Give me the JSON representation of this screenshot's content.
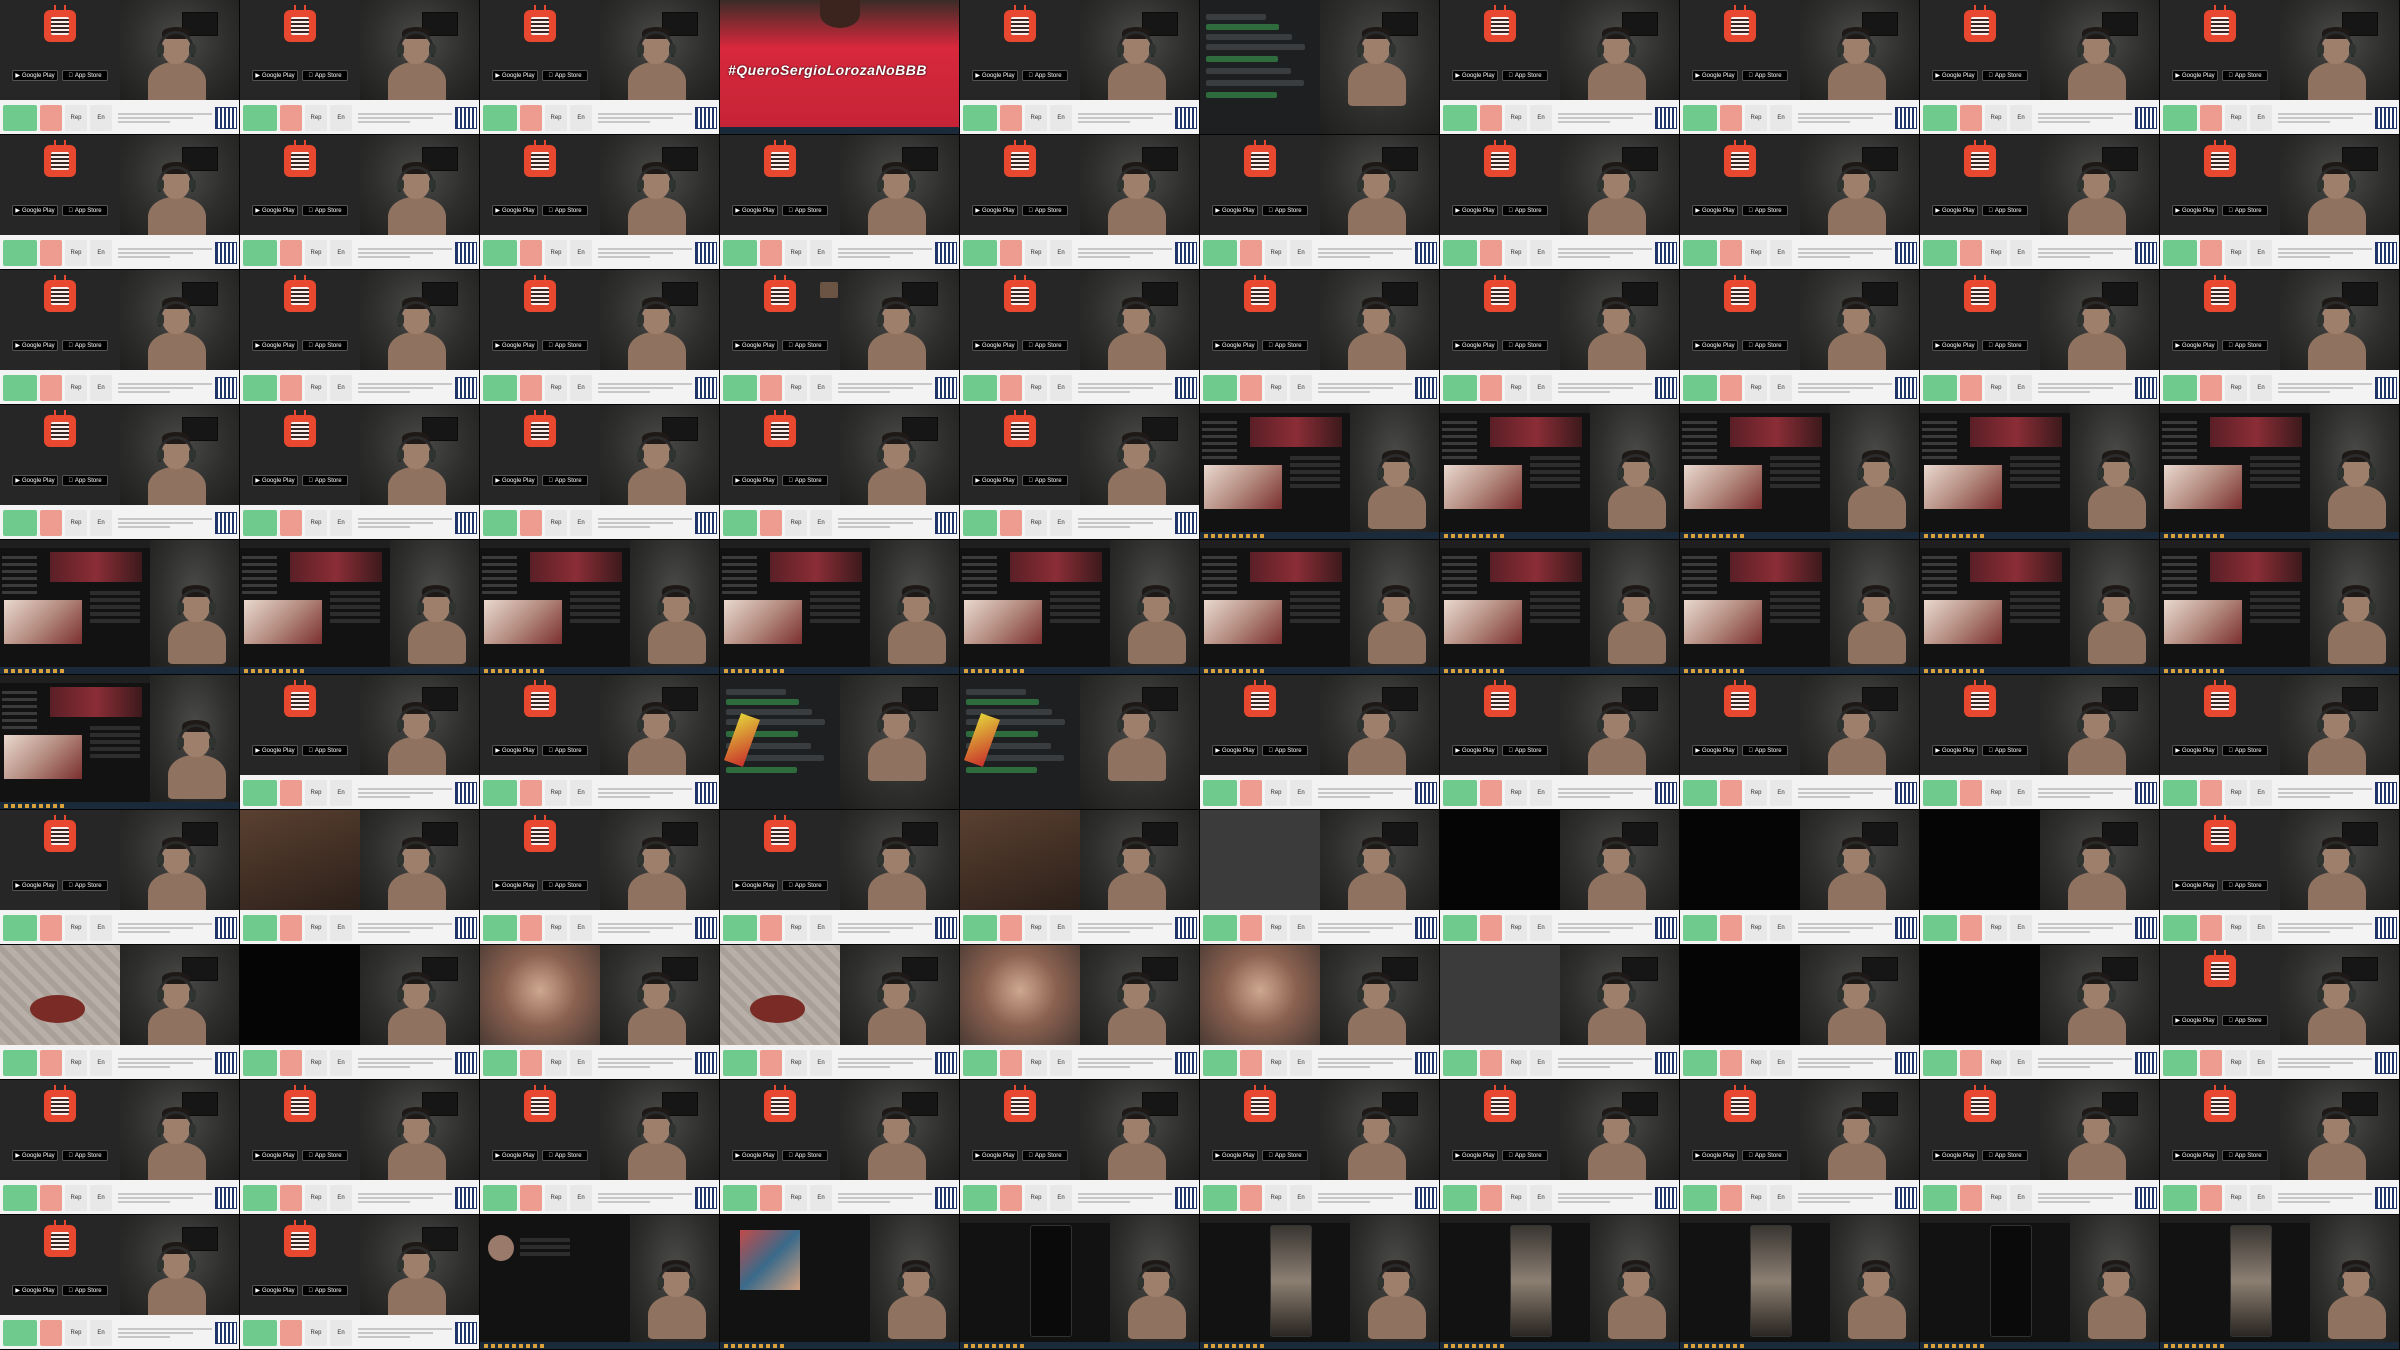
{
  "sheet": {
    "rows": 10,
    "cols": 10
  },
  "omegle": {
    "start_label": "",
    "stop_label": "",
    "report_label": "Rep",
    "lang_label": "En",
    "caption": "",
    "google_play": "Google Play",
    "app_store": "App Store",
    "ome_logo": "Ome TV"
  },
  "banner": {
    "hashtag": "#QueroSergioLorozaNoBBB"
  },
  "tiles": [
    "omegle",
    "omegle",
    "omegle",
    "redshirt",
    "omegle",
    "chatdark",
    "omegle-badge",
    "omegle-badge",
    "omegle-badge",
    "omegle-badge",
    "omegle-badge",
    "omegle-badge",
    "omegle-badge",
    "omegle-badge",
    "omegle",
    "omegle",
    "omegle",
    "omegle",
    "omegle",
    "omegle",
    "omegle",
    "omegle",
    "omegle",
    "omegle-avatar",
    "omegle",
    "omegle",
    "omegle",
    "omegle",
    "omegle",
    "omegle",
    "omegle",
    "omegle",
    "omegle",
    "omegle",
    "omegle",
    "app",
    "app",
    "app",
    "app",
    "app",
    "app",
    "app",
    "app",
    "app",
    "app",
    "app",
    "app",
    "app",
    "app",
    "app",
    "app",
    "omegle",
    "omegle",
    "chatdark2",
    "chatdark2",
    "omegle",
    "omegle",
    "omegle",
    "omegle",
    "omegle",
    "omegle",
    "omegle-photo",
    "ome",
    "ome",
    "photo2",
    "grey",
    "black",
    "black",
    "black",
    "omegle",
    "floor",
    "black",
    "face",
    "floor2",
    "face2",
    "face3",
    "grey",
    "black",
    "black",
    "omegle",
    "omegle",
    "omegle",
    "omegle",
    "omegle",
    "omegle",
    "omegle",
    "omegle",
    "omegle",
    "omegle",
    "omegle",
    "omegle",
    "omegle",
    "profile",
    "mosaic",
    "phoneblack",
    "phoneimg",
    "phoneimg",
    "phoneimg",
    "phoneblack",
    "phoneimg"
  ]
}
